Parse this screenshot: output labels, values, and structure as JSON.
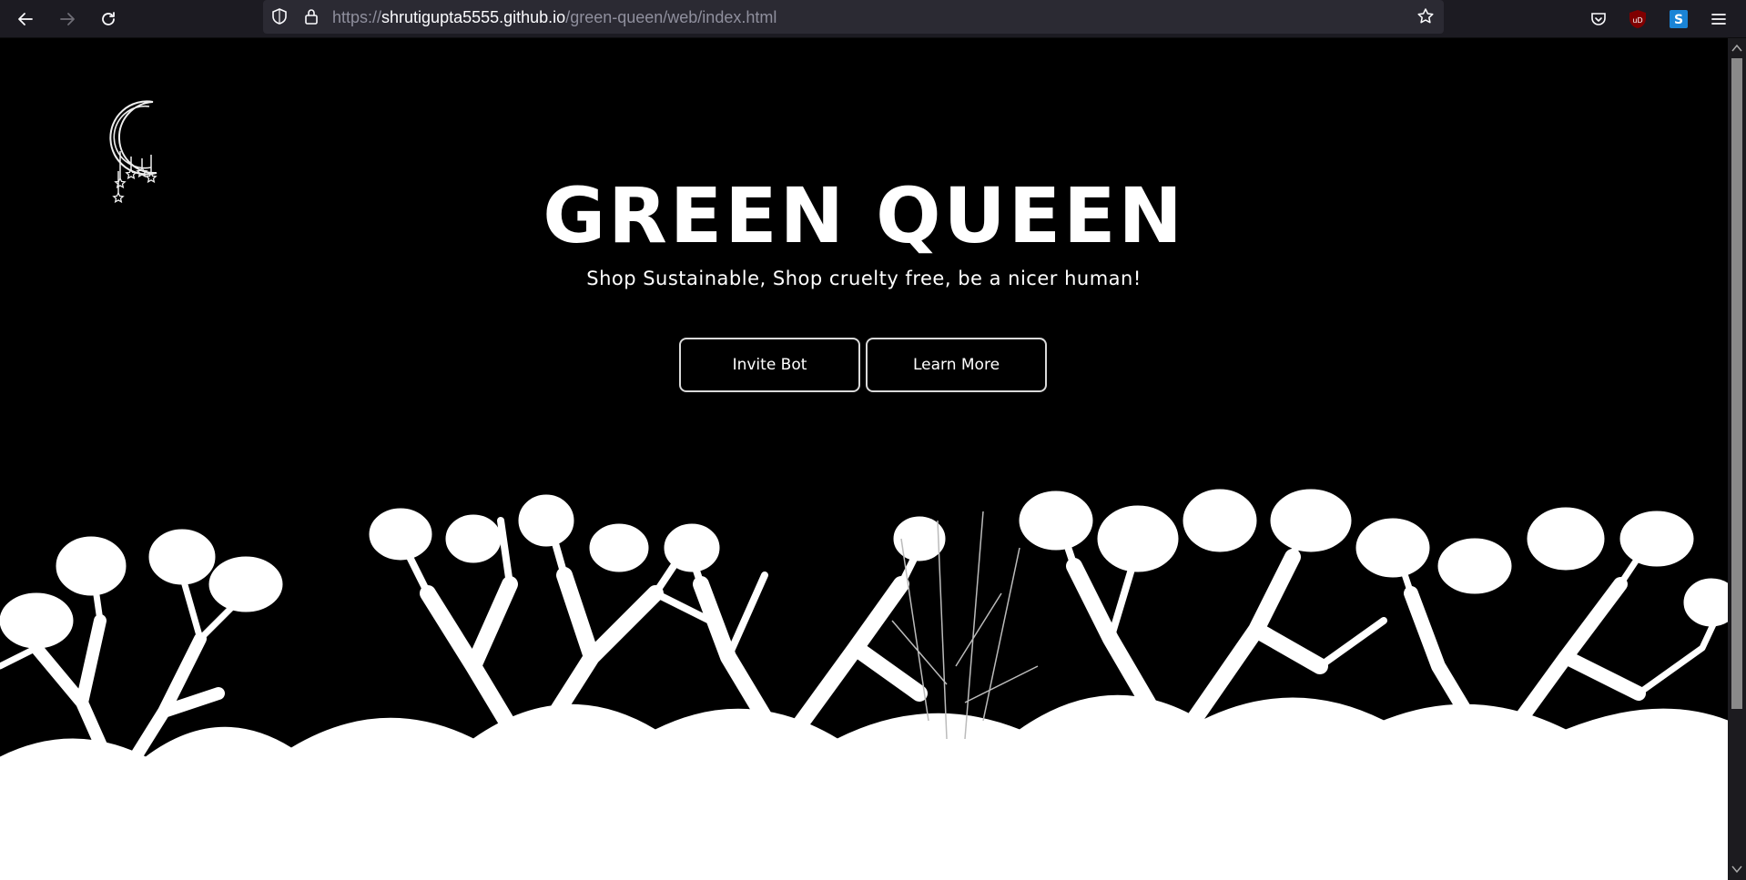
{
  "browser": {
    "url_scheme": "https://",
    "url_host": "shrutigupta5555.github.io",
    "url_path": "/green-queen/web/index.html",
    "icons": [
      "back-icon",
      "forward-icon",
      "reload-icon",
      "shield-icon",
      "lock-icon",
      "bookmark-star-icon",
      "pocket-icon",
      "ublock-icon",
      "extension-s-icon",
      "menu-icon"
    ],
    "ublock_badge": "uD",
    "extension_letter": "S"
  },
  "hero": {
    "title": "GREEN QUEEN",
    "subtitle": "Shop Sustainable, Shop cruelty free, be a nicer human!",
    "buttons": {
      "invite": "Invite Bot",
      "learn": "Learn More"
    }
  },
  "colors": {
    "page_background": "#000000",
    "text": "#ffffff",
    "toolbar": "#1c1b22",
    "urlbar": "#2b2a33",
    "button_border": "#d9d9d9"
  }
}
